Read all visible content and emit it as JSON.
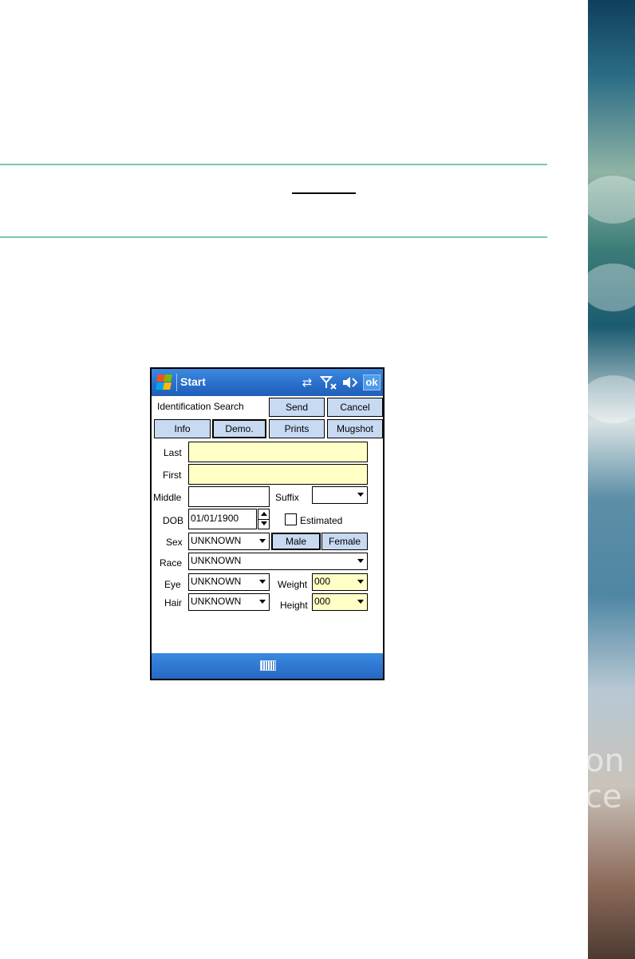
{
  "titlebar": {
    "start_label": "Start",
    "ok_label": "ok",
    "icons": [
      "windows-logo-icon",
      "sync-icon",
      "no-signal-icon",
      "speaker-icon"
    ]
  },
  "header": {
    "title": "Identification Search",
    "send_label": "Send",
    "cancel_label": "Cancel"
  },
  "tabs": [
    {
      "label": "Info",
      "selected": false
    },
    {
      "label": "Demo.",
      "selected": true
    },
    {
      "label": "Prints",
      "selected": false
    },
    {
      "label": "Mugshot",
      "selected": false
    }
  ],
  "form": {
    "last_label": "Last",
    "last_value": "",
    "first_label": "First",
    "first_value": "",
    "middle_label": "Middle",
    "middle_value": "",
    "suffix_label": "Suffix",
    "suffix_value": "",
    "dob_label": "DOB",
    "dob_value": "01/01/1900",
    "estimated_label": "Estimated",
    "estimated_checked": false,
    "sex_label": "Sex",
    "sex_value": "UNKNOWN",
    "male_label": "Male",
    "female_label": "Female",
    "male_selected": true,
    "race_label": "Race",
    "race_value": "UNKNOWN",
    "eye_label": "Eye",
    "eye_value": "UNKNOWN",
    "weight_label": "Weight",
    "weight_value": "000",
    "hair_label": "Hair",
    "hair_value": "UNKNOWN",
    "height_label": "Height",
    "height_value": "000"
  },
  "background": {
    "side_text": [
      "on",
      "ce"
    ]
  },
  "colors": {
    "titlebar": "#2a6fcc",
    "button": "#c8daf2",
    "required_field": "#ffffc6",
    "rule": "#7cc3b4"
  },
  "bottombar": {
    "icon": "keyboard-icon"
  }
}
